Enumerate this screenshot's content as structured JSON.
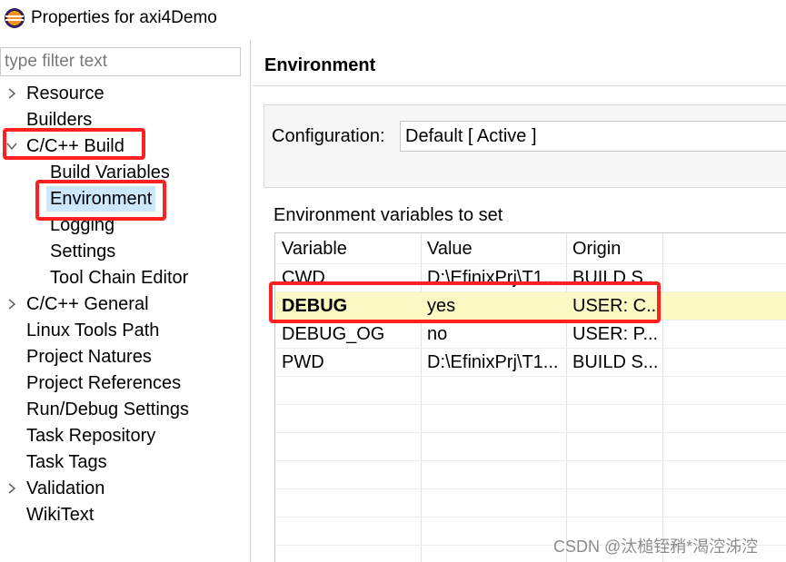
{
  "window": {
    "title": "Properties for axi4Demo",
    "icon": "eclipse-icon"
  },
  "filter": {
    "placeholder": "type filter text"
  },
  "tree": {
    "items": [
      {
        "label": "Resource",
        "expander": "collapsed"
      },
      {
        "label": "Builders"
      },
      {
        "label": "C/C++ Build",
        "expander": "expanded"
      },
      {
        "label": "Build Variables"
      },
      {
        "label": "Environment",
        "selected": true
      },
      {
        "label": "Logging"
      },
      {
        "label": "Settings"
      },
      {
        "label": "Tool Chain Editor"
      },
      {
        "label": "C/C++ General",
        "expander": "collapsed"
      },
      {
        "label": "Linux Tools Path"
      },
      {
        "label": "Project Natures"
      },
      {
        "label": "Project References"
      },
      {
        "label": "Run/Debug Settings"
      },
      {
        "label": "Task Repository"
      },
      {
        "label": "Task Tags"
      },
      {
        "label": "Validation",
        "expander": "collapsed"
      },
      {
        "label": "WikiText"
      }
    ]
  },
  "page": {
    "title": "Environment",
    "configuration_label": "Configuration:",
    "configuration_value": "Default  [ Active ]",
    "variables_label": "Environment variables to set"
  },
  "table": {
    "headers": [
      "Variable",
      "Value",
      "Origin"
    ],
    "rows": [
      [
        "CWD",
        "D:\\EfinixPrj\\T1...",
        "BUILD S..."
      ],
      [
        "DEBUG",
        "yes",
        "USER: C..."
      ],
      [
        "DEBUG_OG",
        "no",
        "USER: P..."
      ],
      [
        "PWD",
        "D:\\EfinixPrj\\T1...",
        "BUILD S..."
      ]
    ]
  },
  "colors": {
    "highlight_box": "#ff2020",
    "selection": "#cce8ff",
    "row_highlight": "#fbf8c4"
  },
  "watermark": "CSDN @汰槌铚矟*渴涳泲涳"
}
